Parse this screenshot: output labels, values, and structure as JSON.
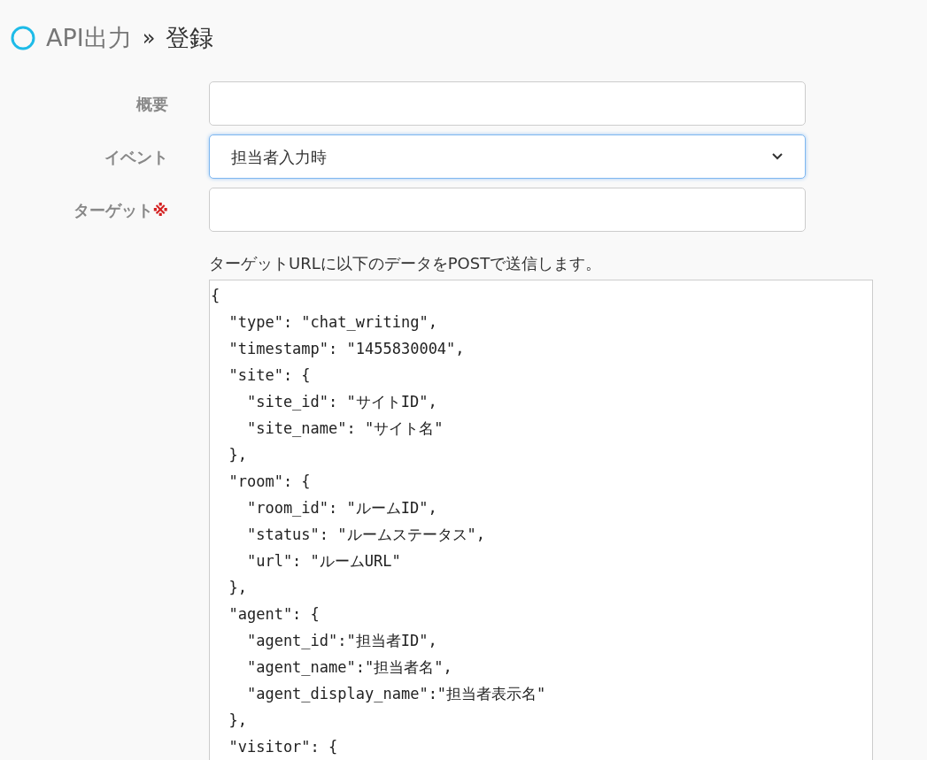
{
  "heading": {
    "section": "API出力",
    "separator": "»",
    "page": "登録"
  },
  "fields": [
    {
      "label": "概要",
      "kind": "text",
      "focused": false
    },
    {
      "label": "イベント",
      "kind": "select",
      "value": "担当者入力時",
      "focused": true
    },
    {
      "label": "ターゲット",
      "required_mark": "※",
      "kind": "text",
      "focused": false
    }
  ],
  "payload": {
    "description": "ターゲットURLに以下のデータをPOSTで送信します。",
    "code": "{\n  \"type\": \"chat_writing\",\n  \"timestamp\": \"1455830004\",\n  \"site\": {\n    \"site_id\": \"サイトID\",\n    \"site_name\": \"サイト名\"\n  },\n  \"room\": {\n    \"room_id\": \"ルームID\",\n    \"status\": \"ルームステータス\",\n    \"url\": \"ルームURL\"\n  },\n  \"agent\": {\n    \"agent_id\":\"担当者ID\",\n    \"agent_name\":\"担当者名\",\n    \"agent_display_name\":\"担当者表示名\"\n  },\n  \"visitor\": {"
  }
}
